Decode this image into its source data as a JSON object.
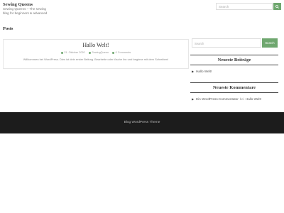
{
  "site": {
    "title": "Sewing Queens",
    "description": "Sewing Queens – The sewing blog for beginners & advanced"
  },
  "search": {
    "placeholder": "Search",
    "button_label": "Search"
  },
  "page": {
    "heading": "Posts"
  },
  "post": {
    "title": "Hallo Welt!",
    "date": "21. Oktober 2020",
    "author": "SewingQueen",
    "comments": "0 Comments",
    "excerpt": "Willkommen bei WordPress. Dies ist dein erster Beitrag. Bearbeite oder lösche ihn und beginne mit dem Schreiben!"
  },
  "sidebar": {
    "recent_posts": {
      "title": "Neueste Beiträge",
      "items": [
        "Hallo Welt!"
      ]
    },
    "recent_comments": {
      "title": "Neueste Kommentare",
      "author": "Ein WordPress-Kommentator",
      "connector": "bei",
      "post": "Hallo Welt!"
    }
  },
  "footer": {
    "text": "Blog WordPress Theme"
  },
  "colors": {
    "accent": "#6fa76f",
    "footer_bg": "#1c1c1c"
  }
}
